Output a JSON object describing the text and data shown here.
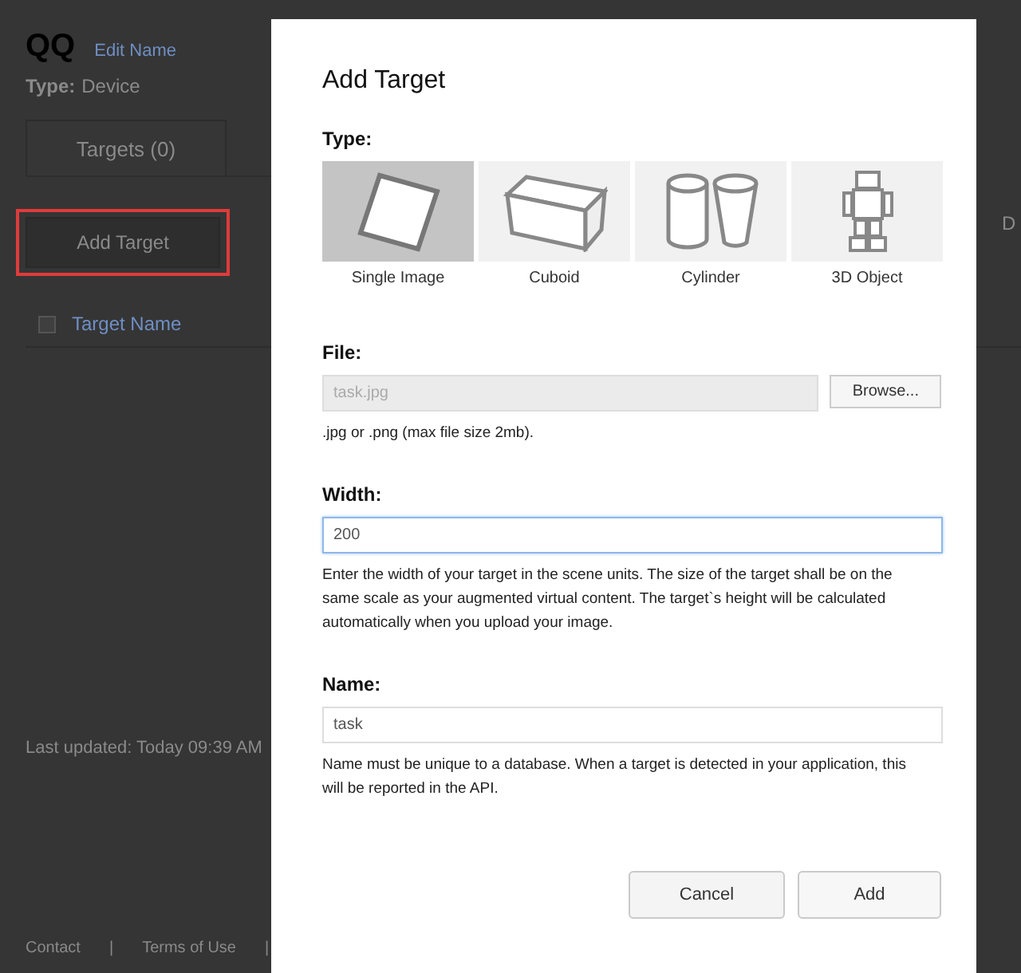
{
  "page": {
    "title": "QQ",
    "edit_link": "Edit Name",
    "type_label": "Type:",
    "type_value": "Device",
    "tabs": [
      {
        "label": "Targets (0)"
      }
    ],
    "add_button": "Add Target",
    "table": {
      "select_all_checked": false,
      "columns": [
        "Target Name"
      ],
      "column_cut": "D"
    },
    "last_updated": "Last updated: Today 09:39 AM",
    "footer": [
      "Contact",
      "|",
      "Terms of Use",
      "|"
    ]
  },
  "dialog": {
    "title": "Add Target",
    "type_label": "Type:",
    "types": [
      {
        "kind": "image",
        "label": "Single Image",
        "selected": true
      },
      {
        "kind": "cuboid",
        "label": "Cuboid",
        "selected": false
      },
      {
        "kind": "cylinder",
        "label": "Cylinder",
        "selected": false
      },
      {
        "kind": "object",
        "label": "3D Object",
        "selected": false
      }
    ],
    "file": {
      "label": "File:",
      "value": "task.jpg",
      "disabled": true,
      "browse": "Browse...",
      "hint": ".jpg or .png (max file size 2mb)."
    },
    "width": {
      "label": "Width:",
      "value": "200",
      "focused": true,
      "hint": "Enter the width of your target in the scene units. The size of the target shall be on the same scale as your augmented virtual content. The target`s height will be calculated automatically when you upload your image."
    },
    "name": {
      "label": "Name:",
      "value": "task",
      "focused": false,
      "hint": "Name must be unique to a database. When a target is detected in your application, this will be reported in the API."
    },
    "buttons": [
      {
        "label": "Cancel",
        "kind": "secondary"
      },
      {
        "label": "Add",
        "kind": "primary"
      }
    ]
  }
}
